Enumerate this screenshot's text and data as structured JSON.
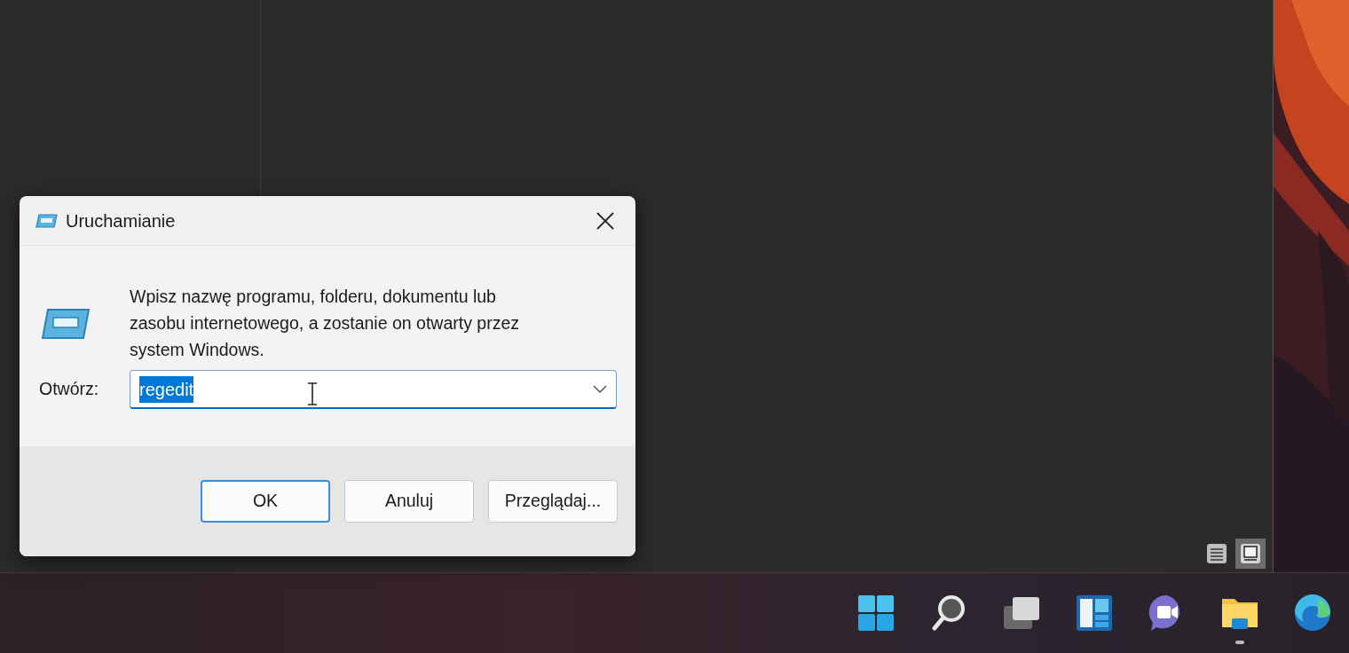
{
  "dialog": {
    "title": "Uruchamianie",
    "message": "Wpisz nazwę programu, folderu, dokumentu lub zasobu internetowego, a zostanie on otwarty przez system Windows.",
    "open_label": "Otwórz:",
    "open_value": "regedit",
    "value_selected": true,
    "buttons": [
      {
        "label": "OK",
        "default": true
      },
      {
        "label": "Anuluj",
        "default": false
      },
      {
        "label": "Przeglądaj...",
        "default": false
      }
    ]
  },
  "view_buttons": [
    {
      "kind": "details",
      "selected": false
    },
    {
      "kind": "tiles",
      "selected": true
    }
  ],
  "taskbar": {
    "apps": [
      {
        "kind": "start",
        "running": false
      },
      {
        "kind": "search",
        "running": false
      },
      {
        "kind": "taskview",
        "running": false
      },
      {
        "kind": "widgets",
        "running": false
      },
      {
        "kind": "chat",
        "running": false
      },
      {
        "kind": "explorer",
        "running": true
      },
      {
        "kind": "edge",
        "running": false
      }
    ]
  }
}
